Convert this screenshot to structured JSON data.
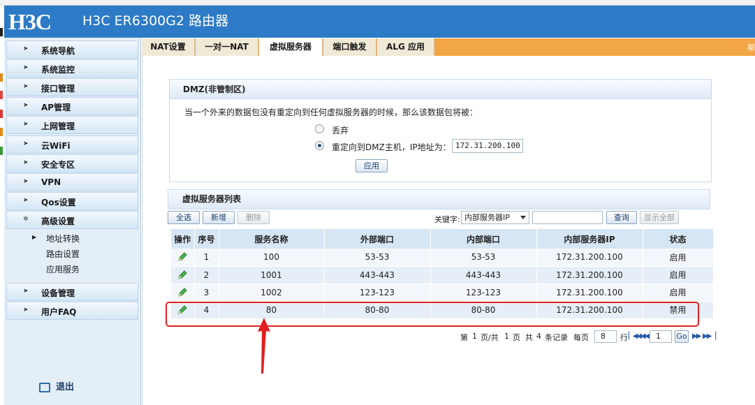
{
  "app": {
    "logo": "H3C",
    "title": "H3C ER6300G2 路由器"
  },
  "sidebar": {
    "items": [
      {
        "label": "系统导航"
      },
      {
        "label": "系统监控"
      },
      {
        "label": "接口管理"
      },
      {
        "label": "AP管理"
      },
      {
        "label": "上网管理"
      },
      {
        "label": "云WiFi"
      },
      {
        "label": "安全专区"
      },
      {
        "label": "VPN"
      },
      {
        "label": "Qos设置"
      },
      {
        "label": "高级设置"
      },
      {
        "label": "设备管理"
      },
      {
        "label": "用户FAQ"
      }
    ],
    "subitems": [
      {
        "label": "地址转换"
      },
      {
        "label": "路由设置"
      },
      {
        "label": "应用服务"
      }
    ],
    "logout": "退出"
  },
  "tabs": [
    {
      "label": "NAT设置"
    },
    {
      "label": "一对一NAT"
    },
    {
      "label": "虚拟服务器"
    },
    {
      "label": "端口触发"
    },
    {
      "label": "ALG 应用"
    }
  ],
  "tabbar_help": "帮",
  "dmz": {
    "title": "DMZ(非管制区)",
    "description": "当一个外来的数据包没有重定向到任何虚拟服务器的时候，那么该数据包将被：",
    "option_discard": "丢弃",
    "option_redirect": "重定向到DMZ主机，IP地址为：",
    "ip": "172.31.200.100",
    "apply": "应用"
  },
  "list": {
    "title": "虚拟服务器列表",
    "select_all": "全选",
    "add": "新增",
    "delete": "删除",
    "keyword_label": "关键字:",
    "keyword_option": "内部服务器IP",
    "search": "查询",
    "show_all": "显示全部"
  },
  "table": {
    "headers": [
      "操作",
      "序号",
      "服务名称",
      "外部端口",
      "内部端口",
      "内部服务器IP",
      "状态"
    ],
    "rows": [
      {
        "index": "1",
        "name": "100",
        "ext_port": "53-53",
        "int_port": "53-53",
        "ip": "172.31.200.100",
        "status": "启用"
      },
      {
        "index": "2",
        "name": "1001",
        "ext_port": "443-443",
        "int_port": "443-443",
        "ip": "172.31.200.100",
        "status": "启用"
      },
      {
        "index": "3",
        "name": "1002",
        "ext_port": "123-123",
        "int_port": "123-123",
        "ip": "172.31.200.100",
        "status": "启用"
      },
      {
        "index": "4",
        "name": "80",
        "ext_port": "80-80",
        "int_port": "80-80",
        "ip": "172.31.200.100",
        "status": "禁用"
      }
    ]
  },
  "pager": {
    "prefix": "第",
    "page": "1",
    "total_pages_text": "页/共",
    "total_pages": "1",
    "pages_unit": "页",
    "records_prefix": "共",
    "records": "4",
    "records_suffix": "条记录",
    "per_page_label": "每页",
    "per_page": "8",
    "rows_label": "行",
    "goto_page": "1",
    "go": "Go"
  },
  "colors": {
    "header_blue": "#2d7bc6",
    "tab_orange": "#f3a646",
    "annotation_red": "#e02020"
  }
}
